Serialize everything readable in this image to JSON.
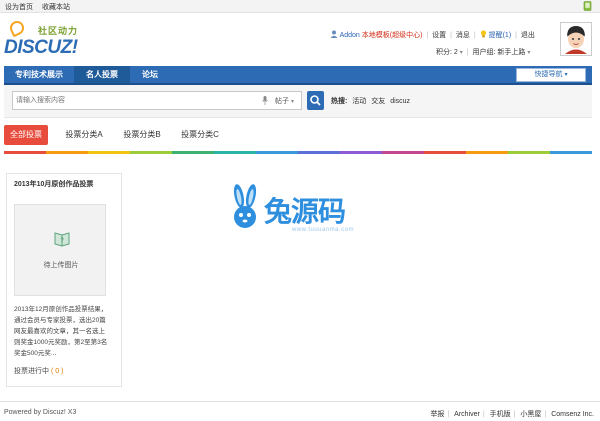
{
  "topbar": {
    "home_link": "设为首页",
    "fav_link": "收藏本站"
  },
  "logo": {
    "word": "DISCUZ!",
    "sub": "社区动力"
  },
  "user": {
    "name": "Addon",
    "badge": "本地模板(超级中心)",
    "settings": "设置",
    "messages": "消息",
    "reminder": "提醒(1)",
    "logout": "退出",
    "points_label": "积分: 2",
    "group_label": "用户组: 新手上路"
  },
  "nav": {
    "items": [
      "专利技术展示",
      "名人投票",
      "论坛"
    ],
    "active_index": 1,
    "quick": "快捷导航"
  },
  "search": {
    "placeholder": "请输入搜索内容",
    "type": "帖子",
    "hot_label": "热搜:",
    "hot_terms": [
      "活动",
      "交友",
      "discuz"
    ]
  },
  "tabs": {
    "items": [
      "全部投票",
      "投票分类A",
      "投票分类B",
      "投票分类C"
    ],
    "active_index": 0
  },
  "rainbow_colors": [
    "#e74c3c",
    "#f39c12",
    "#f1c40f",
    "#9ccc3a",
    "#3cb371",
    "#2bb4a8",
    "#3a9ad9",
    "#5b6fd6",
    "#8e5bd6",
    "#c2478f",
    "#e74c3c",
    "#f39c12",
    "#9ccc3a",
    "#3a9ad9"
  ],
  "poll": {
    "title": "2013年10月原创作品投票",
    "image_caption": "待上传图片",
    "description": "2013年12月原创作品投票结果，通过会员与专家投票，选出20篇网友最喜欢的文章，其一名选上则奖金1000元奖励，第2至第3名奖金500元奖...",
    "status": "投票进行中",
    "count": "( 0 )"
  },
  "watermark": {
    "text": "兔源码",
    "url": "www.tuuuanma.com"
  },
  "footer": {
    "powered": "Powered by Discuz! X3",
    "links": [
      "举报",
      "Archiver",
      "手机版",
      "小黑屋",
      "Comsenz Inc."
    ]
  },
  "colors": {
    "primary": "#2d6cb5",
    "accent": "#e74c3c",
    "link_red": "#d12b14"
  }
}
